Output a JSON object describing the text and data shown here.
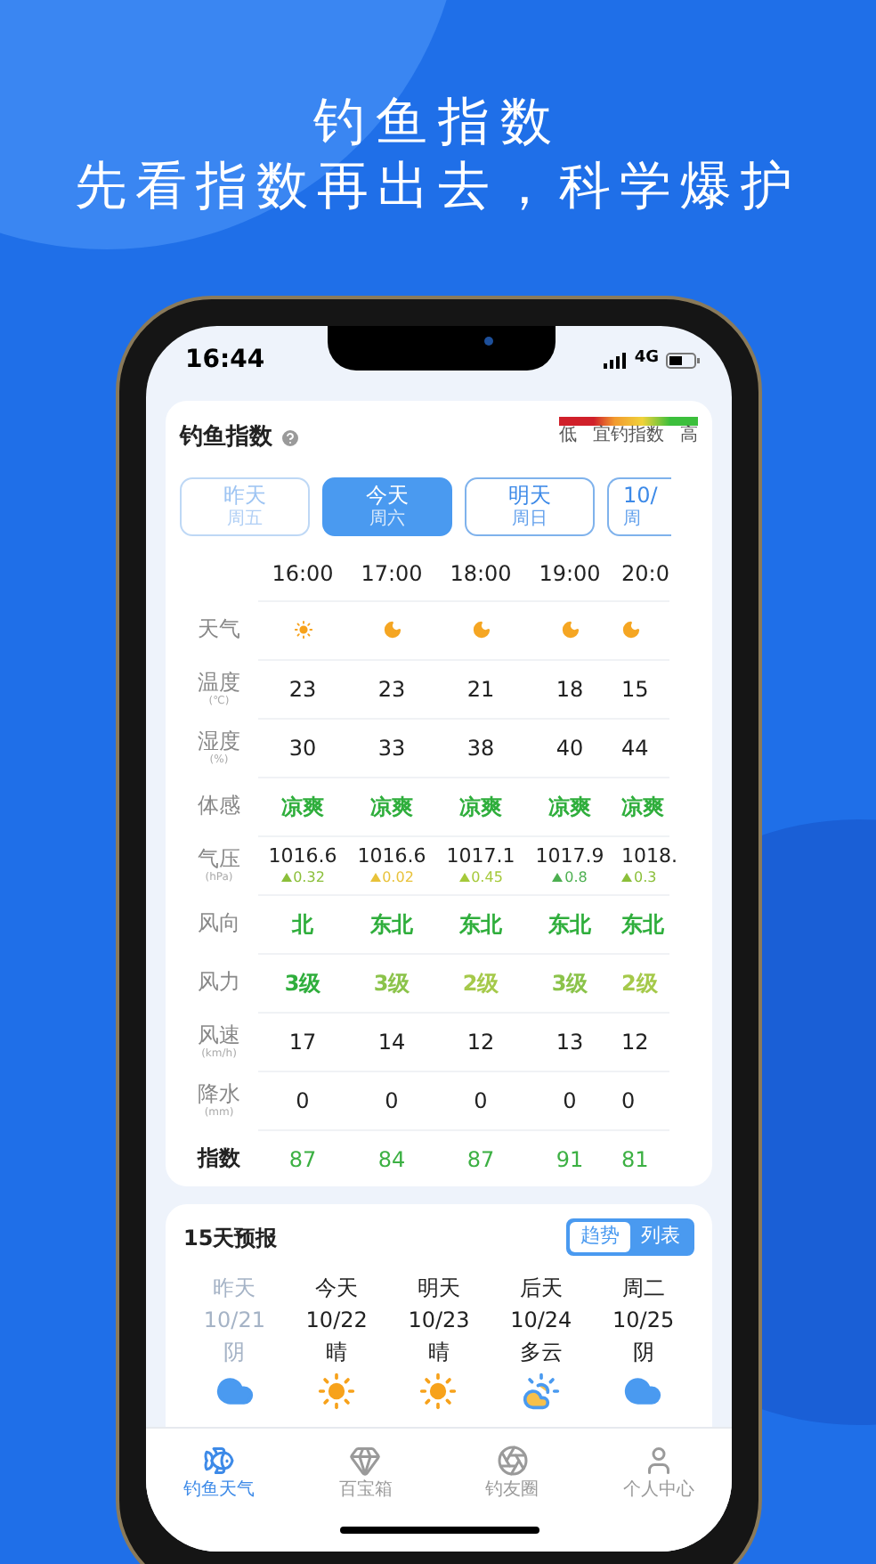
{
  "headline": {
    "title": "钓鱼指数",
    "subtitle": "先看指数再出去，科学爆护"
  },
  "status_bar": {
    "time": "16:44",
    "network": "4G"
  },
  "fishing_index": {
    "title": "钓鱼指数",
    "legend": {
      "low": "低",
      "label": "宜钓指数",
      "high": "高"
    },
    "day_tabs": [
      {
        "label": "昨天",
        "sublabel": "周五",
        "selected": false,
        "disabled": true
      },
      {
        "label": "今天",
        "sublabel": "周六",
        "selected": true,
        "disabled": false
      },
      {
        "label": "明天",
        "sublabel": "周日",
        "selected": false,
        "disabled": false
      },
      {
        "label": "10/",
        "sublabel": "周",
        "selected": false,
        "disabled": false
      }
    ],
    "hours": [
      "16:00",
      "17:00",
      "18:00",
      "19:00",
      "20:0"
    ],
    "rows": [
      {
        "kind": "weather",
        "label": "天气",
        "cells": [
          {
            "kind": "sun"
          },
          {
            "kind": "moon"
          },
          {
            "kind": "moon"
          },
          {
            "kind": "moon"
          },
          {
            "kind": "moon"
          }
        ]
      },
      {
        "kind": "plain",
        "label": "温度",
        "unit": "(℃)",
        "cells": [
          {
            "value": "23"
          },
          {
            "value": "23"
          },
          {
            "value": "21"
          },
          {
            "value": "18"
          },
          {
            "value": "15"
          }
        ]
      },
      {
        "kind": "plain",
        "label": "湿度",
        "unit": "(%)",
        "cells": [
          {
            "value": "30"
          },
          {
            "value": "33"
          },
          {
            "value": "38"
          },
          {
            "value": "40"
          },
          {
            "value": "44"
          }
        ]
      },
      {
        "kind": "colored",
        "label": "体感",
        "cells": [
          {
            "value": "凉爽",
            "color": "#2fae3c"
          },
          {
            "value": "凉爽",
            "color": "#2fae3c"
          },
          {
            "value": "凉爽",
            "color": "#2fae3c"
          },
          {
            "value": "凉爽",
            "color": "#2fae3c"
          },
          {
            "value": "凉爽",
            "color": "#2fae3c"
          }
        ]
      },
      {
        "kind": "pressure",
        "label": "气压",
        "unit": "(hPa)",
        "cells": [
          {
            "value": "1016.6",
            "change": "0.32",
            "color": "#8bbf3a"
          },
          {
            "value": "1016.6",
            "change": "0.02",
            "color": "#e8c23a"
          },
          {
            "value": "1017.1",
            "change": "0.45",
            "color": "#a5c93a"
          },
          {
            "value": "1017.9",
            "change": "0.8",
            "color": "#4caf50"
          },
          {
            "value": "1018.",
            "change": "0.3",
            "color": "#8bbf3a"
          }
        ]
      },
      {
        "kind": "colored",
        "label": "风向",
        "cells": [
          {
            "value": "北",
            "color": "#2fae3c"
          },
          {
            "value": "东北",
            "color": "#2fae3c"
          },
          {
            "value": "东北",
            "color": "#2fae3c"
          },
          {
            "value": "东北",
            "color": "#2fae3c"
          },
          {
            "value": "东北",
            "color": "#2fae3c"
          }
        ]
      },
      {
        "kind": "colored",
        "label": "风力",
        "cells": [
          {
            "value": "3级",
            "color": "#2fae3c"
          },
          {
            "value": "3级",
            "color": "#8bc34a"
          },
          {
            "value": "2级",
            "color": "#a5c94a"
          },
          {
            "value": "3级",
            "color": "#8bc34a"
          },
          {
            "value": "2级",
            "color": "#a5c94a"
          }
        ]
      },
      {
        "kind": "plain",
        "label": "风速",
        "unit": "(km/h)",
        "cells": [
          {
            "value": "17"
          },
          {
            "value": "14"
          },
          {
            "value": "12"
          },
          {
            "value": "13"
          },
          {
            "value": "12"
          }
        ]
      },
      {
        "kind": "plain",
        "label": "降水",
        "unit": "(mm)",
        "cells": [
          {
            "value": "0"
          },
          {
            "value": "0"
          },
          {
            "value": "0"
          },
          {
            "value": "0"
          },
          {
            "value": "0"
          }
        ]
      },
      {
        "kind": "index",
        "label": "指数",
        "cells": [
          {
            "value": "87",
            "color": "#3cb043"
          },
          {
            "value": "84",
            "color": "#3cb043"
          },
          {
            "value": "87",
            "color": "#3cb043"
          },
          {
            "value": "91",
            "color": "#3cb043"
          },
          {
            "value": "81",
            "color": "#3cb043"
          }
        ]
      }
    ]
  },
  "forecast": {
    "title": "15天预报",
    "view_toggle": [
      {
        "label": "趋势",
        "selected": false
      },
      {
        "label": "列表",
        "selected": true
      }
    ],
    "days": [
      {
        "day": "昨天",
        "date": "10/21",
        "weather": "阴",
        "kind": "cloud",
        "past": true
      },
      {
        "day": "今天",
        "date": "10/22",
        "weather": "晴",
        "kind": "sun",
        "past": false
      },
      {
        "day": "明天",
        "date": "10/23",
        "weather": "晴",
        "kind": "sun",
        "past": false
      },
      {
        "day": "后天",
        "date": "10/24",
        "weather": "多云",
        "kind": "partly_cloudy",
        "past": false
      },
      {
        "day": "周二",
        "date": "10/25",
        "weather": "阴",
        "kind": "cloud",
        "past": false
      }
    ]
  },
  "tab_bar": [
    {
      "label": "钓鱼天气",
      "selected": true
    },
    {
      "label": "百宝箱",
      "selected": false
    },
    {
      "label": "钓友圈",
      "selected": false
    },
    {
      "label": "个人中心",
      "selected": false
    }
  ]
}
